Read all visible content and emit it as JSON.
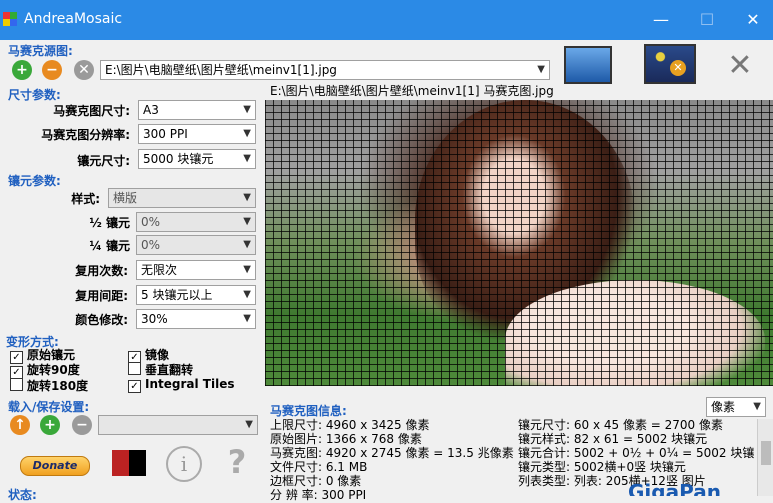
{
  "window": {
    "title": "AndreaMosaic"
  },
  "mosaic_source": {
    "section_label": "马赛克源图:",
    "path": "E:\\图片\\电脑壁纸\\图片壁纸\\meinv1[1].jpg"
  },
  "size_params": {
    "section_label": "尺寸参数:",
    "mosaic_size_label": "马赛克图尺寸:",
    "mosaic_size_value": "A3",
    "resolution_label": "马赛克图分辨率:",
    "resolution_value": "300 PPI",
    "tile_size_label": "镶元尺寸:",
    "tile_size_value": "5000 块镶元"
  },
  "tile_params": {
    "section_label": "镶元参数:",
    "style_label": "样式:",
    "style_value": "横版",
    "half_label": "½ 镶元",
    "half_value": "0%",
    "quarter_label": "¼ 镶元",
    "quarter_value": "0%",
    "reuse_count_label": "复用次数:",
    "reuse_count_value": "无限次",
    "reuse_distance_label": "复用间距:",
    "reuse_distance_value": "5 块镶元以上",
    "color_mod_label": "颜色修改:",
    "color_mod_value": "30%"
  },
  "transform": {
    "section_label": "变形方式:",
    "items": [
      {
        "label": "原始镶元",
        "checked": true
      },
      {
        "label": "镜像",
        "checked": true
      },
      {
        "label": "旋转90度",
        "checked": true
      },
      {
        "label": "垂直翻转",
        "checked": false
      },
      {
        "label": "旋转180度",
        "checked": false
      },
      {
        "label": "Integral Tiles",
        "checked": true
      }
    ]
  },
  "load_save": {
    "section_label": "载入/保存设置:"
  },
  "bottom": {
    "donate_label": "Donate",
    "status_label": "状态:"
  },
  "preview": {
    "caption": "E:\\图片\\电脑壁纸\\图片壁纸\\meinv1[1] 马赛克图.jpg"
  },
  "mosaic_info": {
    "section_label": "马赛克图信息:",
    "unit_value": "像素",
    "left_lines": [
      "上限尺寸: 4960 x 3425 像素",
      "原始图片: 1366 x 768 像素",
      "马赛克图: 4920 x 2745 像素 = 13.5 兆像素",
      "文件尺寸: 6.1 MB",
      "边框尺寸: 0 像素",
      "分 辨 率: 300 PPI"
    ],
    "right_lines": [
      "镶元尺寸: 60 x 45 像素 = 2700 像素",
      "镶元样式: 82 x 61 = 5002 块镶元",
      "镶元合计:  5002 + 0½ + 0¼ = 5002 块镶",
      "镶元类型:  5002横+0竖 块镶元",
      "列表类型:  列表:  205横+12竖 图片"
    ],
    "brand": "GigaPan"
  },
  "colors": {
    "titlebar": "#2b8ae6",
    "section": "#2060c0"
  }
}
